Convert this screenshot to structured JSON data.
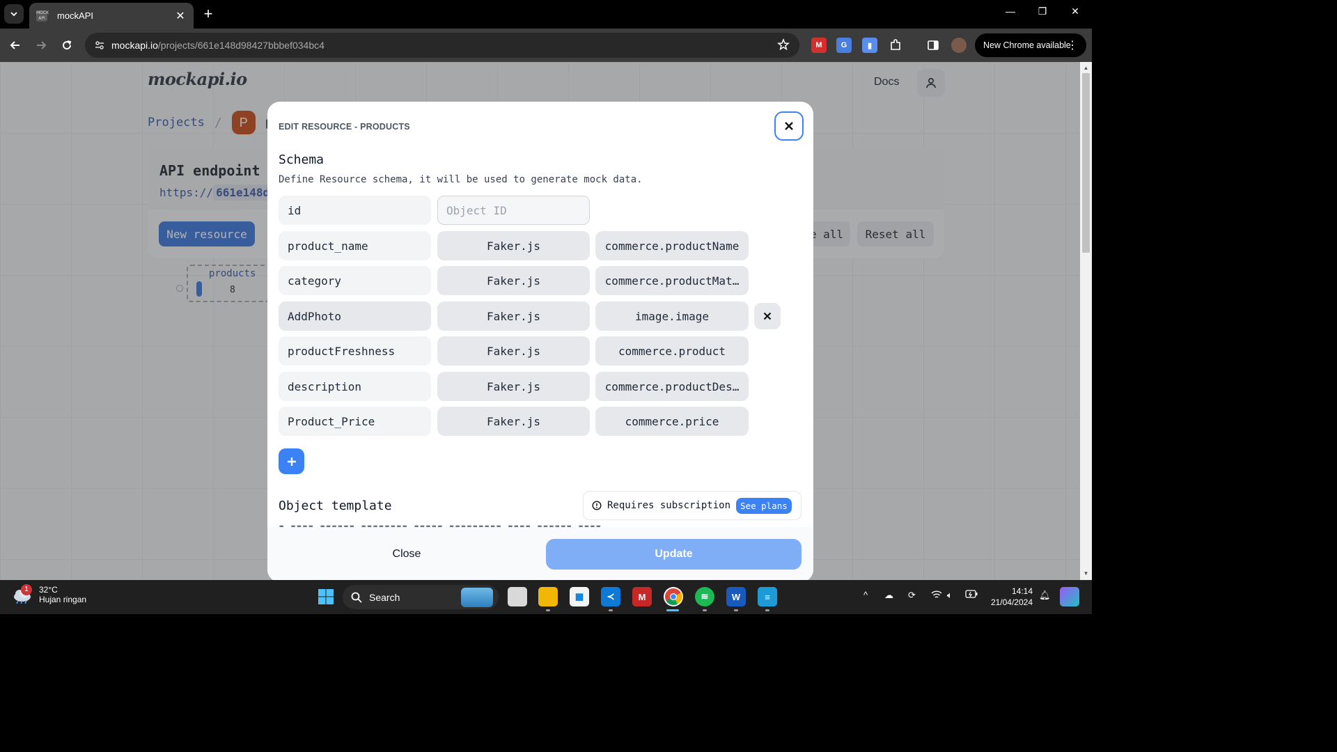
{
  "browser": {
    "tab_title": "mockAPI",
    "favicon_text": "MOCK API",
    "url_host": "mockapi.io",
    "url_path": "/projects/661e148d98427bbbef034bc4",
    "update_badge": "New Chrome available"
  },
  "page": {
    "logo": "mockapi.io",
    "docs_label": "Docs",
    "breadcrumb": {
      "projects": "Projects",
      "separator": "/",
      "avatar_letter": "P",
      "project_name_partial": "p"
    },
    "api_card": {
      "title": "API endpoint",
      "url_prefix": "https://",
      "url_hash_partial": "661e148d"
    },
    "buttons": {
      "new_resource": "New resource",
      "generate_all_partial": "e all",
      "reset_all": "Reset all"
    },
    "resource_node": {
      "name": "products",
      "count": "8"
    }
  },
  "modal": {
    "header": "EDIT RESOURCE - PRODUCTS",
    "schema_title": "Schema",
    "schema_desc": "Define Resource schema, it will be used to generate mock data.",
    "id_field": {
      "name": "id",
      "placeholder": "Object ID"
    },
    "fields": [
      {
        "name": "product_name",
        "type": "Faker.js",
        "method": "commerce.productName"
      },
      {
        "name": "category",
        "type": "Faker.js",
        "method": "commerce.productMat…"
      },
      {
        "name": "AddPhoto",
        "type": "Faker.js",
        "method": "image.image"
      },
      {
        "name": "productFreshness",
        "type": "Faker.js",
        "method": "commerce.product"
      },
      {
        "name": "description",
        "type": "Faker.js",
        "method": "commerce.productDes…"
      },
      {
        "name": "Product_Price",
        "type": "Faker.js",
        "method": "commerce.price"
      }
    ],
    "object_template_title": "Object template",
    "subscription_text": "Requires subscription",
    "see_plans": "See plans",
    "footer_close": "Close",
    "footer_update": "Update"
  },
  "taskbar": {
    "weather_temp": "32°C",
    "weather_desc": "Hujan ringan",
    "weather_badge": "1",
    "search_label": "Search",
    "clock_time": "14:14",
    "clock_date": "21/04/2024"
  },
  "colors": {
    "accent": "#3b82f6",
    "primary_button": "#2f6fdc",
    "update_button_disabled": "#7fadf6",
    "avatar": "#c2410c"
  }
}
